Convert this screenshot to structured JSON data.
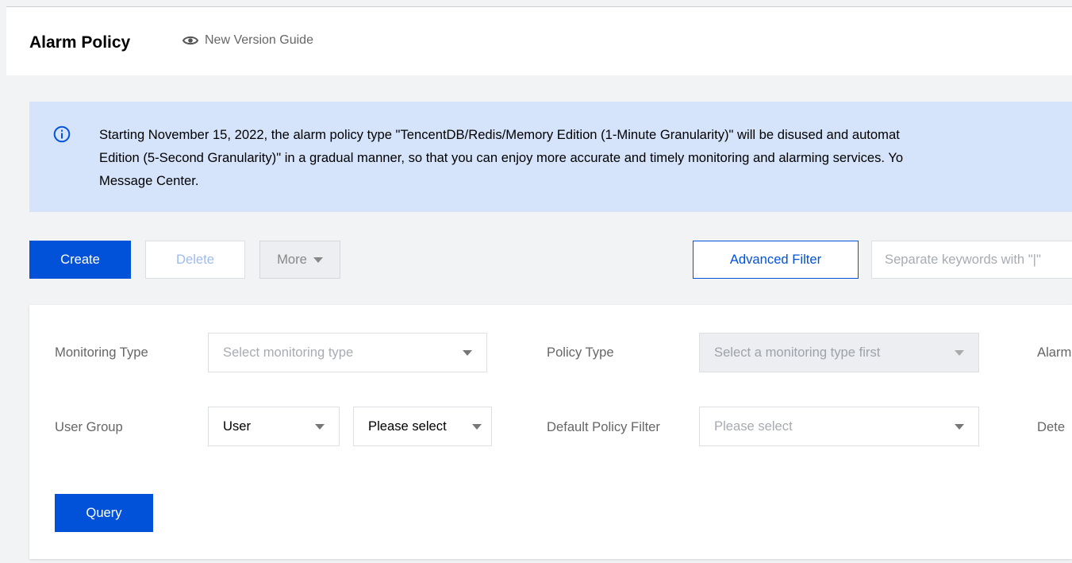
{
  "header": {
    "title": "Alarm Policy",
    "guide_label": "New Version Guide"
  },
  "banner": {
    "icon": "info-circle-icon",
    "lines": [
      "Starting November 15, 2022, the alarm policy type \"TencentDB/Redis/Memory Edition (1-Minute Granularity)\" will be disused and automat",
      "Edition (5-Second Granularity)\" in a gradual manner, so that you can enjoy more accurate and timely monitoring and alarming services. Yo",
      "Message Center."
    ]
  },
  "toolbar": {
    "create_label": "Create",
    "delete_label": "Delete",
    "more_label": "More",
    "advanced_filter_label": "Advanced Filter",
    "search_placeholder": "Separate keywords with \"|\""
  },
  "filters": {
    "monitoring_type": {
      "label": "Monitoring Type",
      "placeholder": "Select monitoring type"
    },
    "policy_type": {
      "label": "Policy Type",
      "placeholder": "Select a monitoring type first"
    },
    "alarm_label": "Alarm",
    "user_group": {
      "label": "User Group",
      "value": "User",
      "secondary_placeholder": "Please select"
    },
    "default_policy_filter": {
      "label": "Default Policy Filter",
      "placeholder": "Please select"
    },
    "detection_label": "Dete",
    "query_label": "Query"
  },
  "colors": {
    "primary": "#0252d9",
    "banner_bg": "#d5e4fb",
    "page_bg": "#f2f3f5"
  }
}
